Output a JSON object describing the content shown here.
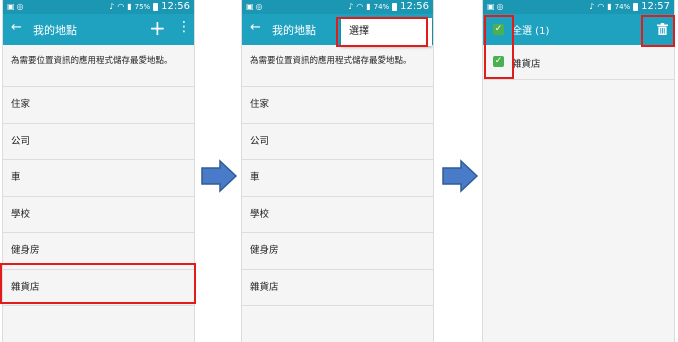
{
  "status_bar": {
    "screen1": {
      "battery": "75%",
      "time": "12:56"
    },
    "screen2": {
      "battery": "74%",
      "time": "12:56"
    },
    "screen3": {
      "battery": "74%",
      "time": "12:57"
    }
  },
  "screen1": {
    "back_icon": "arrow-left",
    "title": "我的地點",
    "add_icon": "+",
    "more_icon": "⋮",
    "description": "為需要位置資訊的應用程式儲存最愛地點。",
    "places": [
      "住家",
      "公司",
      "車",
      "學校",
      "健身房",
      "雜貨店"
    ]
  },
  "screen2": {
    "title": "我的地點",
    "popup_item": "選擇",
    "description": "為需要位置資訊的應用程式儲存最愛地點。",
    "places": [
      "住家",
      "公司",
      "車",
      "學校",
      "健身房",
      "雜貨店"
    ]
  },
  "screen3": {
    "select_all_label": "全選 (1)",
    "selected_item": "雜貨店",
    "delete_icon": "trash-icon"
  },
  "colors": {
    "status_bar": "#1b96b3",
    "toolbar": "#1fa1c0",
    "checkbox": "#4caf50",
    "highlight": "#e21b1b",
    "arrow": "#4a7bc8"
  }
}
